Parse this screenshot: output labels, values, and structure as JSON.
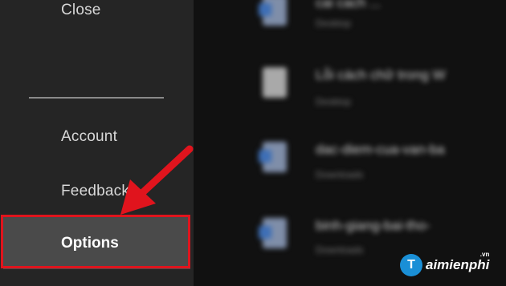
{
  "sidebar": {
    "close_label": "Close",
    "account_label": "Account",
    "feedback_label": "Feedback",
    "options_label": "Options"
  },
  "recent": {
    "items": [
      {
        "title": "cai cach ...",
        "location": "Desktop",
        "icon": "word-doc-icon"
      },
      {
        "title": "Lỗi cách chữ trong W",
        "location": "Desktop",
        "icon": "doc-icon"
      },
      {
        "title": "dac-diem-cua-van-ba",
        "location": "Downloads",
        "icon": "word-doc-icon"
      },
      {
        "title": "binh-giang-bai-tho-",
        "location": "Downloads",
        "icon": "word-doc-icon"
      }
    ]
  },
  "annotation": {
    "color": "#e0141d",
    "icon": "red-arrow-icon"
  },
  "watermark": {
    "brand": "aimienphi",
    "logo_letter": "T",
    "suffix": ".vn"
  }
}
